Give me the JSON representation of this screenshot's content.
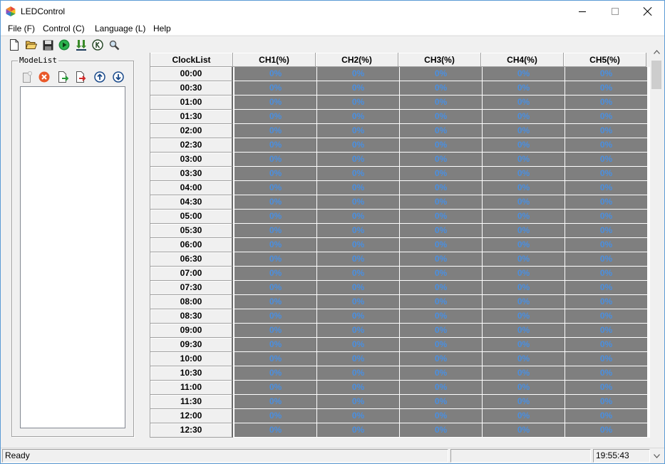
{
  "window": {
    "title": "LEDControl",
    "app_icon": "ledcontrol-app-icon"
  },
  "menu": [
    {
      "label": "File (F)"
    },
    {
      "label": "Control (C)"
    },
    {
      "label": "Language (L)"
    },
    {
      "label": "Help"
    }
  ],
  "toolbar": [
    {
      "name": "new-file-icon"
    },
    {
      "name": "open-folder-icon"
    },
    {
      "name": "save-icon"
    },
    {
      "name": "run-icon"
    },
    {
      "name": "download-icon"
    },
    {
      "name": "clock-icon"
    },
    {
      "name": "search-icon"
    }
  ],
  "modelist": {
    "legend": "ModeList",
    "buttons": [
      {
        "name": "new-mode-icon"
      },
      {
        "name": "delete-mode-icon"
      },
      {
        "name": "import-mode-icon"
      },
      {
        "name": "export-mode-icon"
      },
      {
        "name": "move-up-icon"
      },
      {
        "name": "move-down-icon"
      }
    ]
  },
  "grid": {
    "headers": [
      "ClockList",
      "CH1(%)",
      "CH2(%)",
      "CH3(%)",
      "CH4(%)",
      "CH5(%)"
    ],
    "rows": [
      {
        "time": "00:00",
        "values": [
          "0%",
          "0%",
          "0%",
          "0%",
          "0%"
        ]
      },
      {
        "time": "00:30",
        "values": [
          "0%",
          "0%",
          "0%",
          "0%",
          "0%"
        ]
      },
      {
        "time": "01:00",
        "values": [
          "0%",
          "0%",
          "0%",
          "0%",
          "0%"
        ]
      },
      {
        "time": "01:30",
        "values": [
          "0%",
          "0%",
          "0%",
          "0%",
          "0%"
        ]
      },
      {
        "time": "02:00",
        "values": [
          "0%",
          "0%",
          "0%",
          "0%",
          "0%"
        ]
      },
      {
        "time": "02:30",
        "values": [
          "0%",
          "0%",
          "0%",
          "0%",
          "0%"
        ]
      },
      {
        "time": "03:00",
        "values": [
          "0%",
          "0%",
          "0%",
          "0%",
          "0%"
        ]
      },
      {
        "time": "03:30",
        "values": [
          "0%",
          "0%",
          "0%",
          "0%",
          "0%"
        ]
      },
      {
        "time": "04:00",
        "values": [
          "0%",
          "0%",
          "0%",
          "0%",
          "0%"
        ]
      },
      {
        "time": "04:30",
        "values": [
          "0%",
          "0%",
          "0%",
          "0%",
          "0%"
        ]
      },
      {
        "time": "05:00",
        "values": [
          "0%",
          "0%",
          "0%",
          "0%",
          "0%"
        ]
      },
      {
        "time": "05:30",
        "values": [
          "0%",
          "0%",
          "0%",
          "0%",
          "0%"
        ]
      },
      {
        "time": "06:00",
        "values": [
          "0%",
          "0%",
          "0%",
          "0%",
          "0%"
        ]
      },
      {
        "time": "06:30",
        "values": [
          "0%",
          "0%",
          "0%",
          "0%",
          "0%"
        ]
      },
      {
        "time": "07:00",
        "values": [
          "0%",
          "0%",
          "0%",
          "0%",
          "0%"
        ]
      },
      {
        "time": "07:30",
        "values": [
          "0%",
          "0%",
          "0%",
          "0%",
          "0%"
        ]
      },
      {
        "time": "08:00",
        "values": [
          "0%",
          "0%",
          "0%",
          "0%",
          "0%"
        ]
      },
      {
        "time": "08:30",
        "values": [
          "0%",
          "0%",
          "0%",
          "0%",
          "0%"
        ]
      },
      {
        "time": "09:00",
        "values": [
          "0%",
          "0%",
          "0%",
          "0%",
          "0%"
        ]
      },
      {
        "time": "09:30",
        "values": [
          "0%",
          "0%",
          "0%",
          "0%",
          "0%"
        ]
      },
      {
        "time": "10:00",
        "values": [
          "0%",
          "0%",
          "0%",
          "0%",
          "0%"
        ]
      },
      {
        "time": "10:30",
        "values": [
          "0%",
          "0%",
          "0%",
          "0%",
          "0%"
        ]
      },
      {
        "time": "11:00",
        "values": [
          "0%",
          "0%",
          "0%",
          "0%",
          "0%"
        ]
      },
      {
        "time": "11:30",
        "values": [
          "0%",
          "0%",
          "0%",
          "0%",
          "0%"
        ]
      },
      {
        "time": "12:00",
        "values": [
          "0%",
          "0%",
          "0%",
          "0%",
          "0%"
        ]
      },
      {
        "time": "12:30",
        "values": [
          "0%",
          "0%",
          "0%",
          "0%",
          "0%"
        ]
      }
    ]
  },
  "status": {
    "text": "Ready",
    "middle": "",
    "time": "19:55:43"
  },
  "colors": {
    "cell_bg": "#7f7f7f",
    "cell_text": "#4a8fe0",
    "window_border": "#5b9bd5"
  }
}
